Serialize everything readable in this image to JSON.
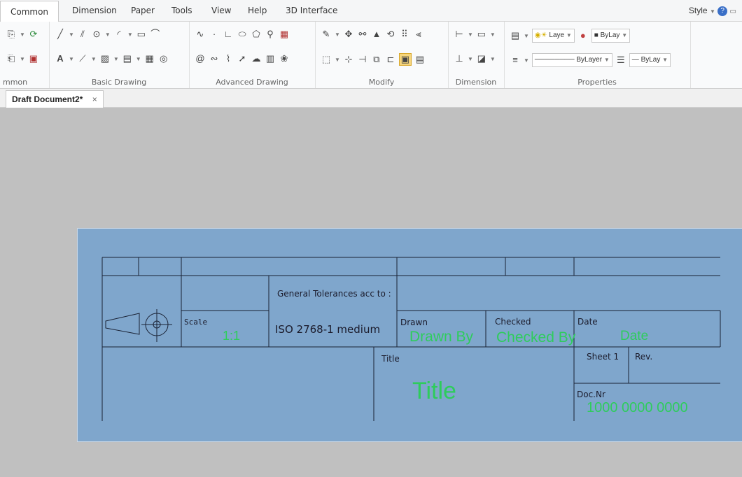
{
  "menu": {
    "tabs": [
      "Common",
      "Dimension",
      "Paper",
      "Tools",
      "View",
      "Help",
      "3D Interface"
    ],
    "style_label": "Style"
  },
  "ribbon": {
    "groups": {
      "common": "mmon",
      "basic": "Basic Drawing",
      "advanced": "Advanced Drawing",
      "modify": "Modify",
      "dimension": "Dimension",
      "properties": "Properties"
    },
    "props": {
      "layer": "Laye",
      "color_by": "ByLay",
      "linetype": "ByLayer",
      "lineweight": "ByLay"
    }
  },
  "document": {
    "tab_title": "Draft Document2*"
  },
  "title_block": {
    "general_tolerances": "General Tolerances acc to :",
    "scale_label": "Scale",
    "scale_value": "1:1",
    "tolerance_value": "ISO 2768-1 medium",
    "drawn_label": "Drawn",
    "drawn_value": "Drawn By",
    "checked_label": "Checked",
    "checked_value": "Checked By",
    "date_label": "Date",
    "date_value": "Date",
    "title_label": "Title",
    "title_value": "Title",
    "sheet_label": "Sheet 1",
    "rev_label": "Rev.",
    "docnr_label": "Doc.Nr",
    "docnr_value": "1000 0000 0000"
  }
}
